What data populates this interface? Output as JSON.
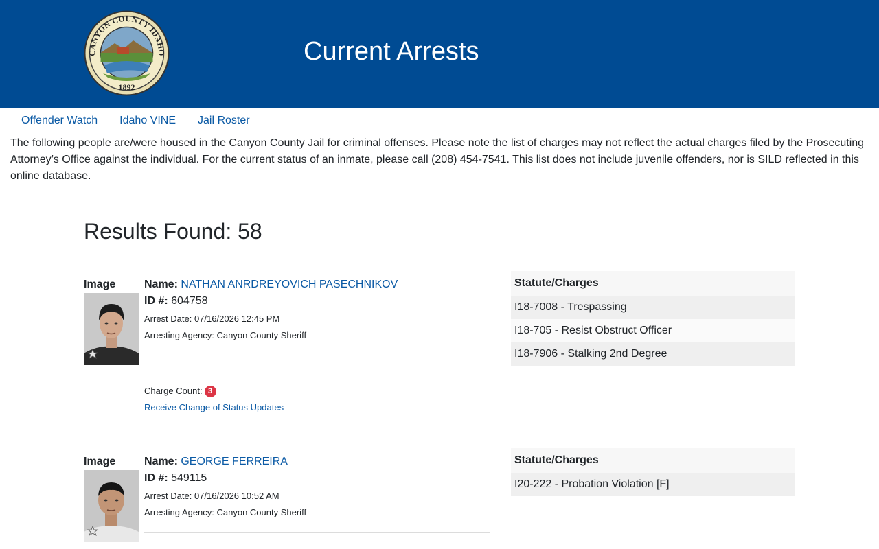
{
  "header": {
    "title": "Current Arrests",
    "seal_text_top": "CANYON COUNTY IDAHO",
    "seal_year": "1892",
    "brand_color": "#004b93"
  },
  "nav": {
    "items": [
      {
        "label": "Offender Watch"
      },
      {
        "label": "Idaho VINE"
      },
      {
        "label": "Jail Roster"
      }
    ]
  },
  "intro": "The following people are/were housed in the Canyon County Jail for criminal offenses. Please note the list of charges may not reflect the actual charges filed by the Prosecuting Attorney’s Office against the individual. For the current status of an inmate, please call (208) 454-7541. This list does not include juvenile offenders, nor is SILD reflected in this online database.",
  "results": {
    "label": "Results Found: 58"
  },
  "labels": {
    "image": "Image",
    "name": "Name:",
    "id": "ID #:",
    "charge_count": "Charge Count:",
    "status_link": "Receive Change of Status Updates",
    "charges_header": "Statute/Charges"
  },
  "records": [
    {
      "name": "NATHAN ANRDREYOVICH PASECHNIKOV",
      "id": "604758",
      "arrest_date": "Arrest Date: 07/16/2026 12:45 PM",
      "agency": "Arresting Agency: Canyon County Sheriff",
      "charge_count": "3",
      "charges": [
        "I18-7008 - Trespassing",
        "I18-705 - Resist Obstruct Officer",
        "I18-7906 - Stalking 2nd Degree"
      ]
    },
    {
      "name": "GEORGE FERREIRA",
      "id": "549115",
      "arrest_date": "Arrest Date: 07/16/2026 10:52 AM",
      "agency": "Arresting Agency: Canyon County Sheriff",
      "charges": [
        "I20-222 - Probation Violation [F]"
      ]
    }
  ]
}
